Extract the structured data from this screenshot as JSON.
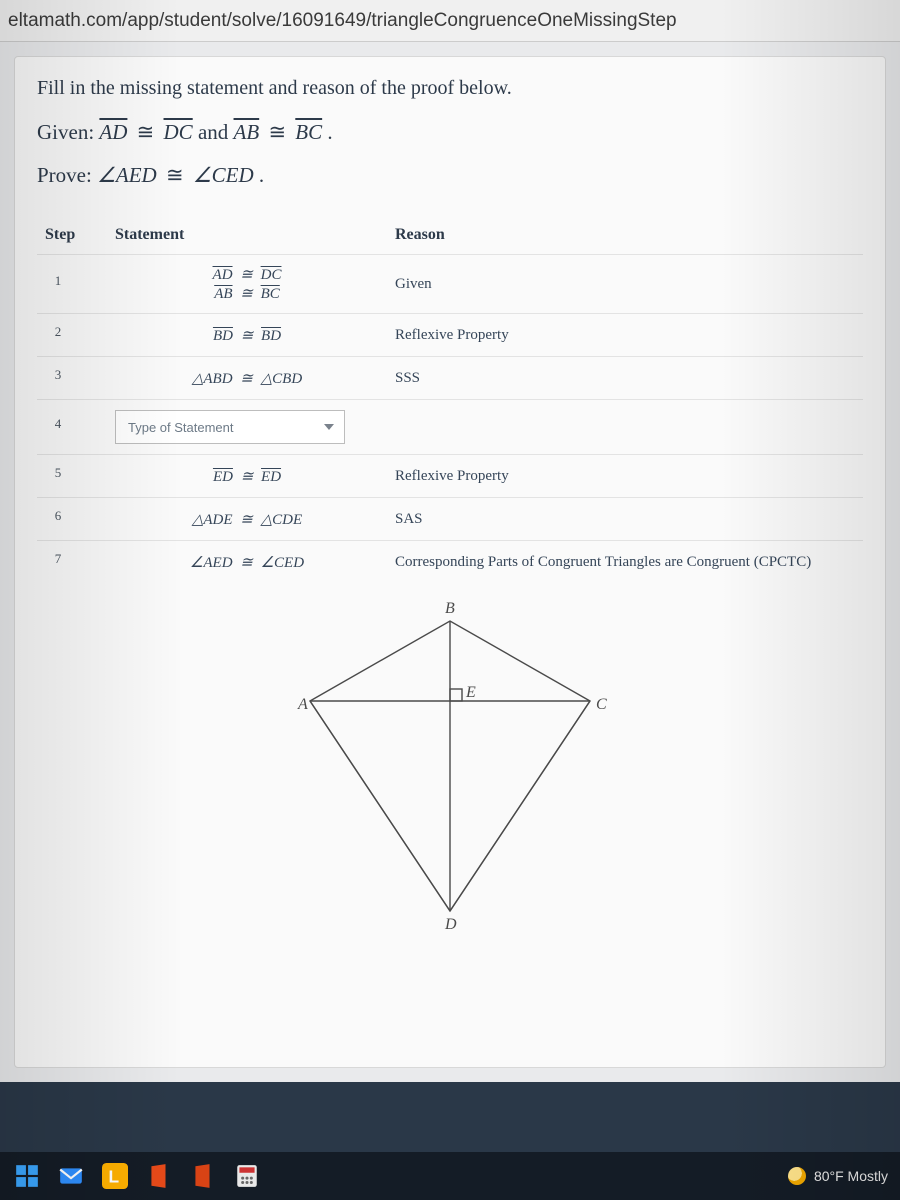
{
  "address_bar": {
    "url": "eltamath.com/app/student/solve/16091649/triangleCongruenceOneMissingStep"
  },
  "page": {
    "instruction": "Fill in the missing statement and reason of the proof below.",
    "given_prefix": "Given: ",
    "given_seg1": "AD",
    "given_cong": " ≅ ",
    "given_seg2": "DC",
    "given_and": " and ",
    "given_seg3": "AB",
    "given_seg4": "BC",
    "given_period": ".",
    "prove_prefix": "Prove: ",
    "prove_a1": "∠AED",
    "prove_cong": " ≅ ",
    "prove_a2": "∠CED",
    "prove_period": "."
  },
  "table": {
    "head_step": "Step",
    "head_statement": "Statement",
    "head_reason": "Reason",
    "rows": [
      {
        "step": "1",
        "stmt_html": "lines",
        "stmt_l1a": "AD",
        "stmt_l1b": "DC",
        "stmt_l2a": "AB",
        "stmt_l2b": "BC",
        "reason": "Given"
      },
      {
        "step": "2",
        "stmt_single_a": "BD",
        "stmt_single_b": "BD",
        "reason": "Reflexive Property"
      },
      {
        "step": "3",
        "stmt_tri_a": "△ABD",
        "stmt_tri_b": "△CBD",
        "reason": "SSS"
      },
      {
        "step": "4",
        "dropdown_placeholder": "Type of Statement",
        "reason": ""
      },
      {
        "step": "5",
        "stmt_single_a": "ED",
        "stmt_single_b": "ED",
        "reason": "Reflexive Property"
      },
      {
        "step": "6",
        "stmt_tri_a": "△ADE",
        "stmt_tri_b": "△CDE",
        "reason": "SAS"
      },
      {
        "step": "7",
        "stmt_ang_a": "∠AED",
        "stmt_ang_b": "∠CED",
        "reason": "Corresponding Parts of Congruent Triangles are Congruent (CPCTC)"
      }
    ]
  },
  "figure": {
    "labels": {
      "A": "A",
      "B": "B",
      "C": "C",
      "D": "D",
      "E": "E"
    }
  },
  "taskbar": {
    "weather_text": "80°F  Mostly "
  }
}
